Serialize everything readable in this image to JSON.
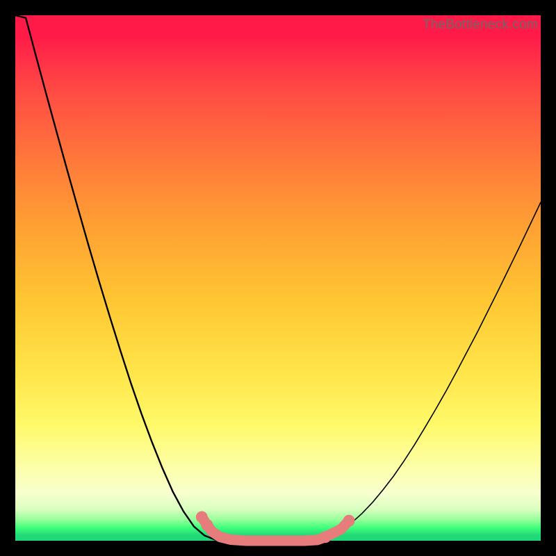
{
  "watermark": "TheBottleneck.com",
  "chart_data": {
    "type": "line",
    "title": "",
    "xlabel": "",
    "ylabel": "",
    "xlim": [
      0,
      100
    ],
    "ylim": [
      0,
      100
    ],
    "grid": false,
    "x": [
      0,
      2,
      4,
      6,
      8,
      10,
      12,
      14,
      16,
      18,
      20,
      22,
      24,
      26,
      28,
      30,
      32,
      34,
      36,
      38,
      40,
      42,
      44,
      46,
      48,
      50,
      52,
      54,
      56,
      58,
      60,
      62,
      64,
      66,
      68,
      70,
      72,
      74,
      76,
      78,
      80,
      82,
      84,
      86,
      88,
      90,
      92,
      94,
      96,
      98,
      100
    ],
    "series": [
      {
        "name": "bottleneck-curve",
        "values": [
          107,
          99.5,
          92,
          84.6,
          77.3,
          70.1,
          63,
          56,
          49.2,
          42.6,
          36.2,
          30,
          24.2,
          18.8,
          13.8,
          9.3,
          5.6,
          2.7,
          1,
          0.2,
          0,
          0,
          0,
          0,
          0,
          0,
          0,
          0,
          0,
          0.3,
          1,
          2,
          3.4,
          5.2,
          7.3,
          9.7,
          12.3,
          15.2,
          18.3,
          21.6,
          25,
          28.5,
          32.2,
          36,
          39.8,
          43.8,
          47.8,
          51.9,
          56,
          60.2,
          64.4
        ]
      }
    ],
    "markers": {
      "name": "highlight-region",
      "color": "#e77c7c",
      "points": [
        {
          "x": 35.5,
          "y": 4.5
        },
        {
          "x": 36.5,
          "y": 3.0
        },
        {
          "x": 37.5,
          "y": 1.7
        },
        {
          "x": 39.0,
          "y": 0.7
        },
        {
          "x": 41.0,
          "y": 0.2
        },
        {
          "x": 44.0,
          "y": 0.0
        },
        {
          "x": 48.0,
          "y": 0.0
        },
        {
          "x": 52.0,
          "y": 0.0
        },
        {
          "x": 55.0,
          "y": 0.0
        },
        {
          "x": 57.5,
          "y": 0.15
        },
        {
          "x": 59.0,
          "y": 0.7
        },
        {
          "x": 62.0,
          "y": 2.2
        },
        {
          "x": 63.5,
          "y": 3.8
        }
      ]
    }
  }
}
